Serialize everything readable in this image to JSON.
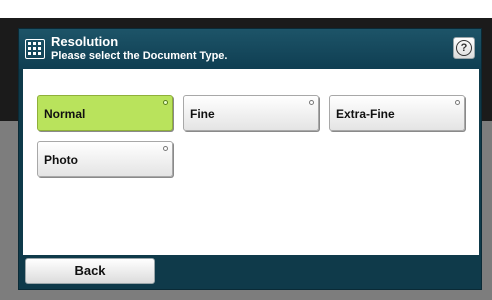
{
  "header": {
    "title": "Resolution",
    "subtitle": "Please select the Document Type.",
    "menu_icon": "grid-menu-icon",
    "help_icon": "question-icon",
    "help_glyph": "?"
  },
  "options": [
    {
      "label": "Normal",
      "selected": true
    },
    {
      "label": "Fine",
      "selected": false
    },
    {
      "label": "Extra-Fine",
      "selected": false
    },
    {
      "label": "Photo",
      "selected": false
    }
  ],
  "footer": {
    "back_label": "Back"
  },
  "colors": {
    "header": "#1d5468",
    "panel_frame": "#0f3a4a",
    "selected_option": "#b9e35c"
  }
}
